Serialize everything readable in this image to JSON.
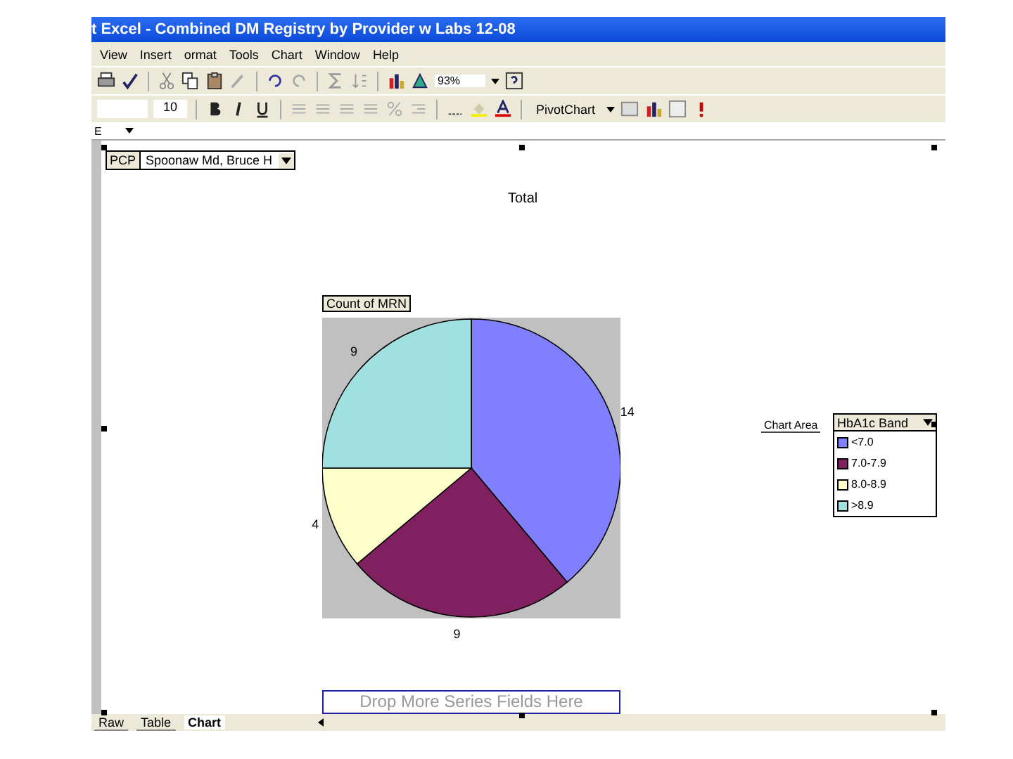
{
  "window": {
    "title": "t Excel - Combined DM Registry by Provider w Labs 12-08"
  },
  "menu": [
    "View",
    "Insert",
    "ormat",
    "Tools",
    "Chart",
    "Window",
    "Help"
  ],
  "toolbar": {
    "zoom": "93%",
    "font_size": "10",
    "pivot_menu": "PivotChart"
  },
  "name_box": {
    "value": "E"
  },
  "page_field": {
    "label": "PCP",
    "value": "Spoonaw Md, Bruce H"
  },
  "chart": {
    "title": "Total",
    "data_field": "Count of MRN",
    "tooltip": "Chart Area",
    "drop_zone": "Drop More Series Fields Here",
    "legend": {
      "field": "HbA1c Band",
      "items": [
        {
          "color": "#8080ff"
        },
        {
          "color": "#802060"
        },
        {
          "color": "#ffffcc"
        },
        {
          "color": "#a0e0e0"
        }
      ]
    },
    "chart_data": {
      "type": "pie",
      "categories": [
        "<7.0",
        "7.0-7.9",
        "8.0-8.9",
        ">8.9"
      ],
      "values": [
        14,
        9,
        4,
        9
      ],
      "data_labels": true
    }
  },
  "sheet_tabs": [
    {
      "label": "Raw",
      "selected": false
    },
    {
      "label": "Table",
      "selected": false
    },
    {
      "label": "Chart",
      "selected": true
    }
  ]
}
